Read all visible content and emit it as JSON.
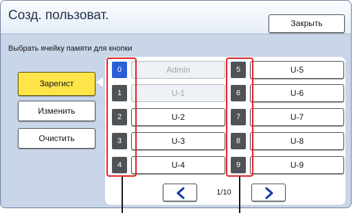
{
  "header": {
    "title": "Созд. пользоват.",
    "close_label": "Закрыть"
  },
  "instruction": "Выбрать ячейку памяти для кнопки",
  "modes": {
    "register_label": "Зарегист",
    "edit_label": "Изменить",
    "clear_label": "Очистить",
    "active": "register"
  },
  "slots": [
    {
      "number": "0",
      "name": "Admin",
      "selected": true,
      "disabled": true
    },
    {
      "number": "1",
      "name": "U-1",
      "disabled": true
    },
    {
      "number": "2",
      "name": "U-2"
    },
    {
      "number": "3",
      "name": "U-3"
    },
    {
      "number": "4",
      "name": "U-4"
    },
    {
      "number": "5",
      "name": "U-5"
    },
    {
      "number": "6",
      "name": "U-6"
    },
    {
      "number": "7",
      "name": "U-7"
    },
    {
      "number": "8",
      "name": "U-8"
    },
    {
      "number": "9",
      "name": "U-9"
    }
  ],
  "pagination": {
    "page_label": "1/10"
  },
  "icons": {
    "prev": "chevron-left-icon",
    "next": "chevron-right-icon"
  },
  "colors": {
    "highlight": "#e0201e",
    "active_button": "#ffe54a",
    "selected_slot": "#2a5fd6"
  }
}
